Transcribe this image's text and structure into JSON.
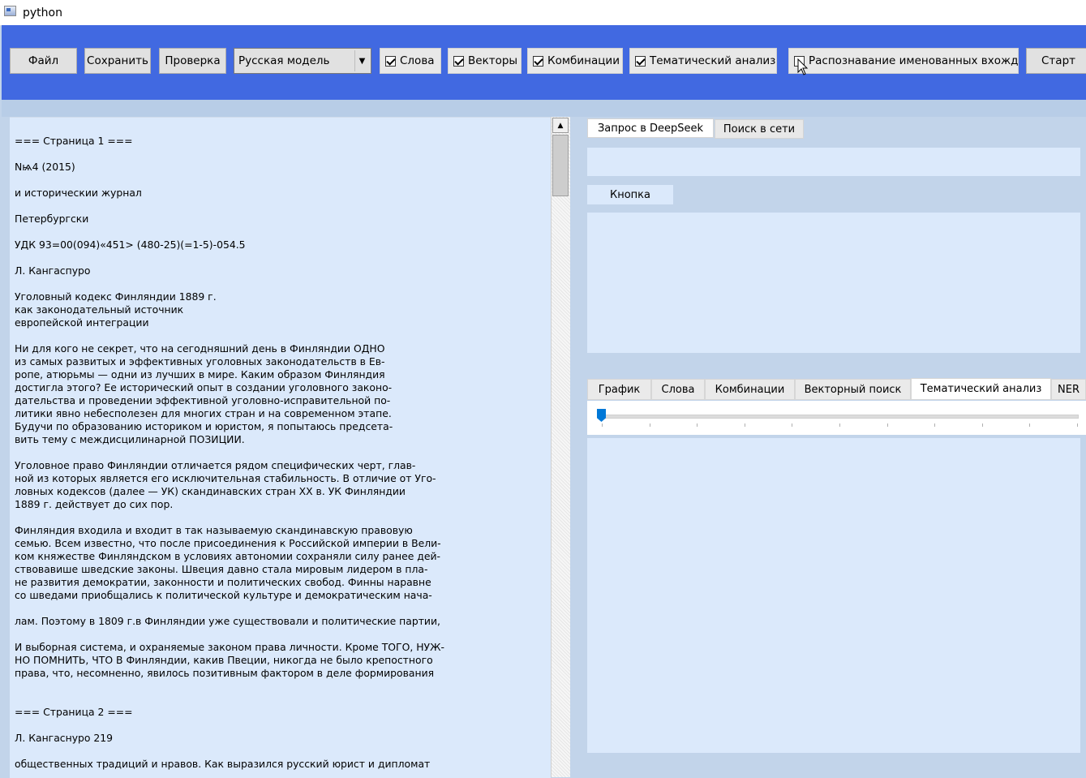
{
  "window": {
    "title": "python"
  },
  "toolbar": {
    "file_label": "Файл",
    "save_label": "Сохранить",
    "check_label": "Проверка",
    "model_select": {
      "value": "Русская модель"
    },
    "checkboxes": [
      {
        "label": "Слова",
        "checked": true
      },
      {
        "label": "Векторы",
        "checked": true
      },
      {
        "label": "Комбинации",
        "checked": true
      },
      {
        "label": "Тематический анализ",
        "checked": true
      },
      {
        "label": "Распознавание именованных вхождени",
        "checked": false
      }
    ],
    "start_label": "Старт",
    "accent_color": "#4169e1"
  },
  "document": {
    "lines": [
      "=== Страница 1 ===",
      "Nѩ4 (2015)",
      "и историчeскии журнал",
      "Петербургски",
      "УДК 93=00(094)«451> (480-25)(=1-5)-054.5",
      "Л. Кангаспуро",
      "Уголовный кодекс Финляндии 1889 г.",
      "как законодательный источник",
      "европейской интеграции",
      "Ни для кого не секрет, что на сегодняшний день в Финляндии ОДНО",
      "из самых развитых и эффективных уголовных законодательств в Ев-",
      "ропе, атюрьмы — одни из лучших в мире. Каким образом Финляндия",
      "достигла этого? Ее исторический опыт в создании уголовного законо-",
      "дательства и проведении эффективной уголовно-исправительной по-",
      "литики явно небесполезен для многих стран и на современном этапе.",
      "Будучи по образованию историком и юристом, я попытаюсь предсета-",
      "вить тему с междисцилинарной ПОЗИЦИИ.",
      "Уголовное право Финляндии отличается рядом специфических черт, глав-",
      "ной из которых является его исключительная стабильность. В отличие от Уго-",
      "ловных кодексов (далее — УК) скандинавских стран XX в. УК Финляндии",
      "1889 г. действует до сих пор.",
      "Финляндия входила и входит в так называемую скандинавскую правовую",
      "семью. Всем известно, что после присоединения к Российской империи в Вели-",
      "ком княжестве Финляндском в условиях автономии сохраняли силу ранее дей-",
      "ствовавише шведские законы. Швеция давно стала мировым лидером в пла-",
      "не развития демократии, законности и политических свобод. Финны наравне",
      "со шведами приобщались к политической культуре и демократическим нача-",
      "лам. Поэтому в 1809 г.в Финляндии уже существовали и политические партии,",
      "И выборная система, и охраняемые законом права личности. Кроме ТОГО, НУЖ-",
      "НО ПОМНИТЬ, ЧТО В Финляндии, какив Пвеции, никогда не было крепостного",
      "права, что, несомненно, явилось позитивным фактором в деле формирования",
      "=== Страница 2 ===",
      "Л. Кангаснуро 219",
      "общественных традиций и нравов. Как выразился русский юрист и дипломат"
    ]
  },
  "right_panel": {
    "tabs": [
      {
        "label": "Запрос в DeepSeek",
        "active": true
      },
      {
        "label": "Поиск в сети",
        "active": false
      }
    ],
    "button_label": "Кнопка",
    "lower_tabs": [
      {
        "label": "График",
        "active": false
      },
      {
        "label": "Слова",
        "active": false
      },
      {
        "label": "Комбинации",
        "active": false
      },
      {
        "label": "Векторный поиск",
        "active": false
      },
      {
        "label": "Тематический анализ",
        "active": true
      },
      {
        "label": "NER",
        "active": false
      }
    ],
    "slider": {
      "value": 0,
      "tick_count": 11
    }
  }
}
